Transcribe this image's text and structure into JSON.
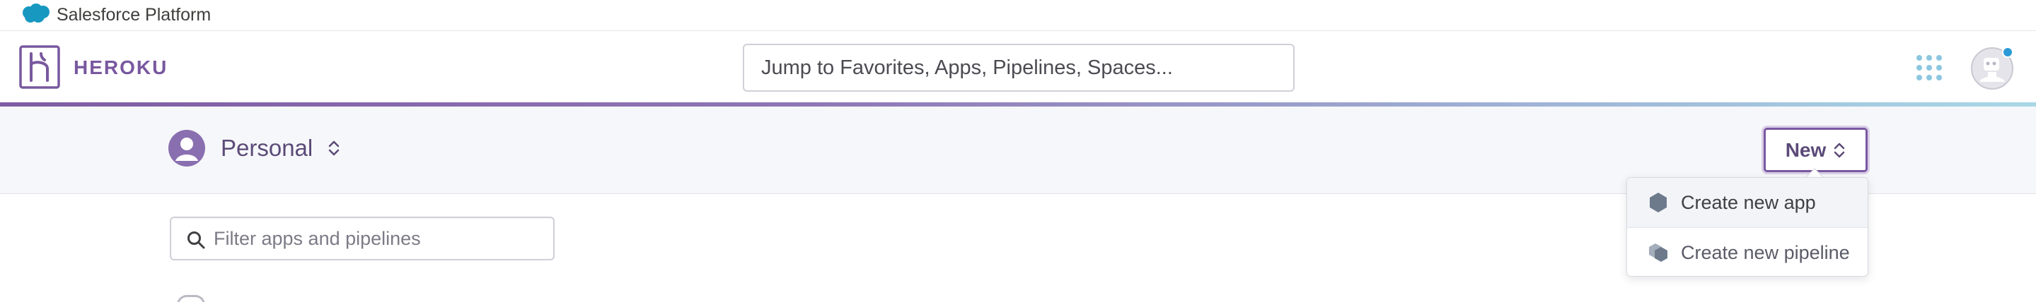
{
  "salesforce": {
    "title": "Salesforce Platform",
    "icon": "salesforce-cloud-icon"
  },
  "header": {
    "brand": "HEROKU",
    "logo_icon": "heroku-logo-icon",
    "search_placeholder": "Jump to Favorites, Apps, Pipelines, Spaces...",
    "apps_icon": "apps-grid-icon",
    "avatar_icon": "user-avatar-icon"
  },
  "subheader": {
    "account_label": "Personal",
    "new_button_label": "New"
  },
  "dropdown": {
    "items": [
      {
        "label": "Create new app",
        "icon": "app-hexagon-icon"
      },
      {
        "label": "Create new pipeline",
        "icon": "pipeline-hexagons-icon"
      }
    ]
  },
  "filter": {
    "placeholder": "Filter apps and pipelines"
  },
  "colors": {
    "brand_purple": "#79589f",
    "salesforce_blue": "#1798c1",
    "grid_blue": "#8cc6e0",
    "subheader_bg": "#f6f7fa"
  }
}
